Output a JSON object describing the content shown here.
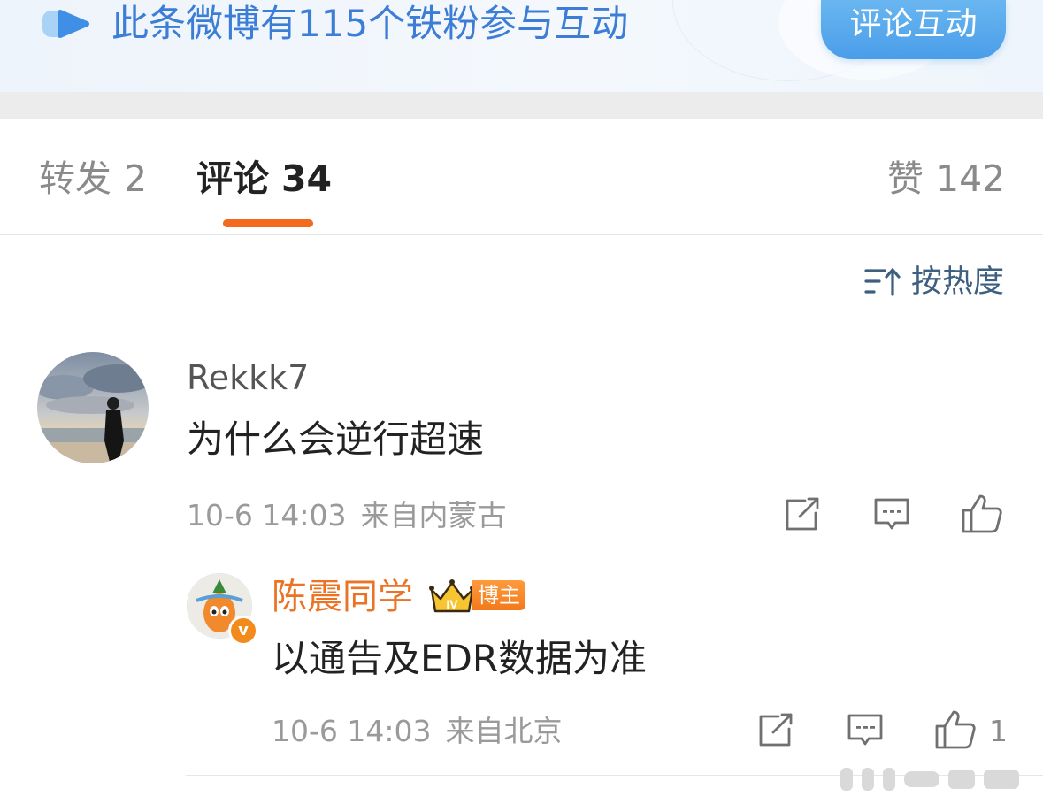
{
  "banner": {
    "text": "此条微博有115个铁粉参与互动",
    "button_label": "评论互动",
    "accent": "#3c7ed6"
  },
  "tabs": {
    "repost_label": "转发",
    "repost_count": "2",
    "comment_label": "评论",
    "comment_count": "34",
    "like_label": "赞",
    "like_count": "142",
    "active": "comment",
    "indicator_color": "#f36a1e"
  },
  "sort": {
    "icon": "sort-icon",
    "label": "按热度"
  },
  "comments": [
    {
      "username": "Rekkk7",
      "text": "为什么会逆行超速",
      "time": "10-6 14:03",
      "source": "来自内蒙古",
      "icons": [
        "share-icon",
        "comment-icon",
        "like-icon"
      ]
    }
  ],
  "reply": {
    "username": "陈震同学",
    "badge": "博主",
    "level_icon": "crown-iv-icon",
    "text": "以通告及EDR数据为准",
    "time": "10-6 14:03",
    "source": "来自北京",
    "like_count": "1",
    "name_color": "#eb7326"
  }
}
